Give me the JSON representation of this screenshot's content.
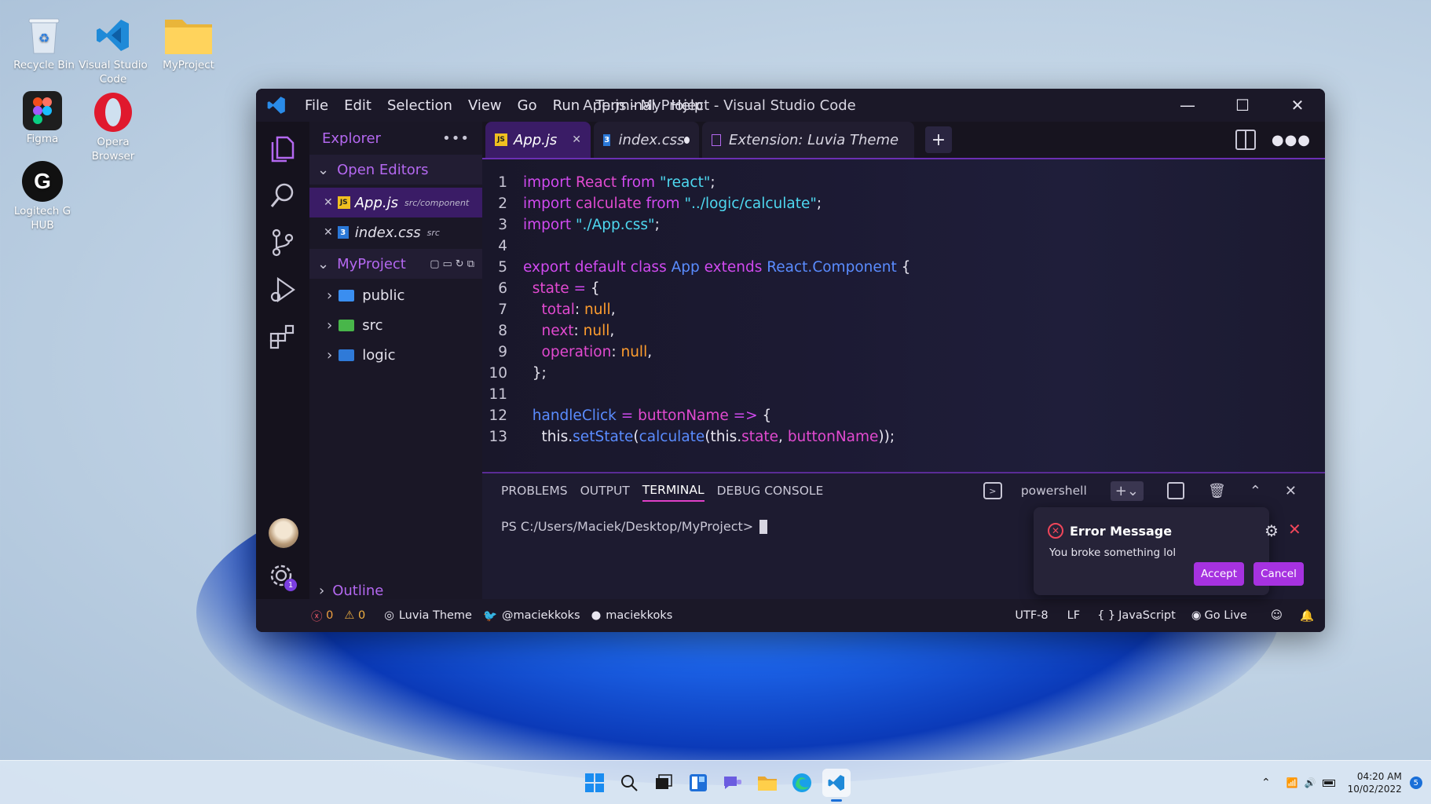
{
  "desktop": {
    "icons": [
      {
        "label": "Recycle Bin"
      },
      {
        "label": "Visual Studio Code"
      },
      {
        "label": "MyProject"
      },
      {
        "label": "Figma"
      },
      {
        "label": "Opera Browser"
      },
      {
        "label": "Logitech G HUB"
      }
    ]
  },
  "window": {
    "title": "App.js - MyProject - Visual Studio Code",
    "menu": [
      "File",
      "Edit",
      "Selection",
      "View",
      "Go",
      "Run",
      "Terminal",
      "Help"
    ]
  },
  "sidebar": {
    "title": "Explorer",
    "open_editors_label": "Open Editors",
    "open_editors": [
      {
        "name": "App.js",
        "path": "src/component",
        "icon": "JS"
      },
      {
        "name": "index.css",
        "path": "src",
        "icon": "3"
      }
    ],
    "project_label": "MyProject",
    "folders": [
      "public",
      "src",
      "logic"
    ],
    "outline_label": "Outline",
    "settings_badge": "1"
  },
  "tabs": [
    {
      "label": "App.js",
      "icon": "JS"
    },
    {
      "label": "index.css",
      "icon": "3"
    },
    {
      "label": "Extension: Luvia Theme"
    }
  ],
  "code": {
    "line_numbers": [
      "1",
      "2",
      "3",
      "4",
      "5",
      "6",
      "7",
      "8",
      "9",
      "10",
      "11",
      "12",
      "13"
    ]
  },
  "panel": {
    "tabs": [
      "PROBLEMS",
      "OUTPUT",
      "TERMINAL",
      "DEBUG CONSOLE"
    ],
    "shell": "powershell",
    "prompt": "PS C:/Users/Maciek/Desktop/MyProject>"
  },
  "toast": {
    "title": "Error Message",
    "message": "You broke something lol",
    "accept": "Accept",
    "cancel": "Cancel"
  },
  "statusbar": {
    "errors": "0",
    "warnings": "0",
    "theme": "Luvia Theme",
    "twitter": "@maciekkoks",
    "github": "maciekkoks",
    "encoding": "UTF-8",
    "eol": "LF",
    "language": "JavaScript",
    "golive": "Go Live"
  },
  "taskbar": {
    "time": "04:20 AM",
    "date": "10/02/2022",
    "notifications": "5"
  },
  "colors": {
    "accent": "#b468f0",
    "keyword": "#d14af0",
    "string": "#4ed8f0",
    "button": "#a632e0"
  }
}
